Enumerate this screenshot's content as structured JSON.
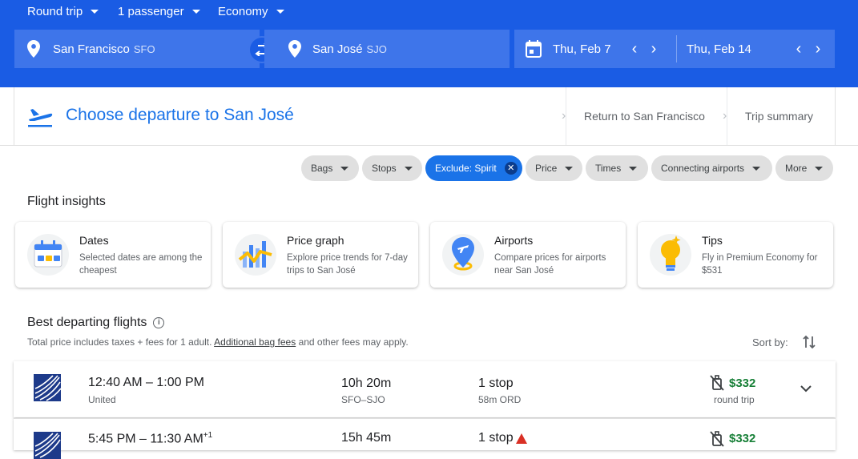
{
  "search": {
    "trip_type": "Round trip",
    "passengers": "1 passenger",
    "cabin": "Economy",
    "origin": {
      "city": "San Francisco",
      "code": "SFO"
    },
    "destination": {
      "city": "San José",
      "code": "SJO"
    },
    "depart_date": "Thu, Feb 7",
    "return_date": "Thu, Feb 14"
  },
  "steps": {
    "current": "Choose departure to San José",
    "next": "Return to San Francisco",
    "summary": "Trip summary"
  },
  "filters": [
    {
      "label": "Bags",
      "active": false
    },
    {
      "label": "Stops",
      "active": false
    },
    {
      "label": "Exclude: Spirit",
      "active": true
    },
    {
      "label": "Price",
      "active": false
    },
    {
      "label": "Times",
      "active": false
    },
    {
      "label": "Connecting airports",
      "active": false
    },
    {
      "label": "More",
      "active": false
    }
  ],
  "insights": {
    "heading": "Flight insights",
    "cards": [
      {
        "title": "Dates",
        "desc": "Selected dates are among the cheapest",
        "icon": "calendar-icon"
      },
      {
        "title": "Price graph",
        "desc": "Explore price trends for 7-day trips to San José",
        "icon": "chart-icon"
      },
      {
        "title": "Airports",
        "desc": "Compare prices for airports near San José",
        "icon": "airport-pin-icon"
      },
      {
        "title": "Tips",
        "desc": "Fly in Premium Economy for $531",
        "icon": "lightbulb-icon"
      }
    ]
  },
  "results": {
    "heading": "Best departing flights",
    "note_prefix": "Total price includes taxes + fees for 1 adult.",
    "note_link": "Additional bag fees",
    "note_suffix": "and other fees may apply.",
    "sort_label": "Sort by:",
    "flights": [
      {
        "times": "12:40 AM – 1:00 PM",
        "airline": "United",
        "duration": "10h 20m",
        "route": "SFO–SJO",
        "stops": "1 stop",
        "stop_detail": "58m ORD",
        "price": "$332",
        "price_note": "round trip"
      },
      {
        "times": "5:45 PM – 11:30 AM",
        "day_offset": "+1",
        "duration": "15h 45m",
        "stops": "1 stop",
        "price": "$332"
      }
    ]
  },
  "colors": {
    "brand": "#1a5ce4",
    "field": "#3e75ea",
    "accent_text": "#1a73e8",
    "price_green": "#188038",
    "warning": "#d93025"
  }
}
